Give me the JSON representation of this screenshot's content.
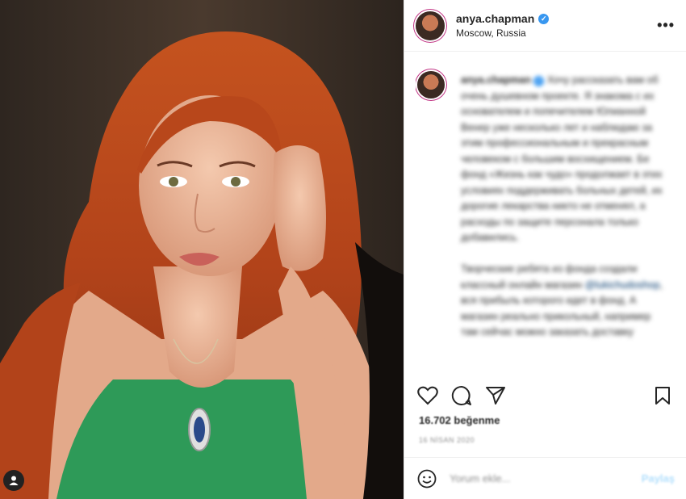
{
  "post": {
    "image_alt": "Portrait photo of a woman with long red hair",
    "tag_icon": "user-tag-icon"
  },
  "header": {
    "username": "anya.chapman",
    "verified": "✓",
    "location": "Moscow, Russia",
    "more": "•••"
  },
  "caption": {
    "username": "anya.chapman",
    "text1": "Хочу рассказать вам об очень душевном проекте. Я знакома с их основателем и попечителем Юлианной Венер уже несколько лет и наблюдаю за этим профессиональным и прекрасным человеком с большим восхищением. Бе фонд «Жизнь как чудо» продолжает в этих условиях поддерживать больных детей, их дорогие лекарства никто не отменял, а расходы по защите персонала только добавились.",
    "text2": "Творческие ребята из фонда создали классный онлайн магазин",
    "link": "@lukichudoshop",
    "text3": ", вся прибыль которого идет в фонд. А магазин реально прикольный, например там сейчас можно заказать доставку"
  },
  "stats": {
    "likes": "16.702 beğenme",
    "date": "16 NİSAN 2020"
  },
  "comment": {
    "placeholder": "Yorum ekle...",
    "post_label": "Paylaş"
  },
  "colors": {
    "verified": "#3897f0",
    "link": "#00376b",
    "muted": "#8e8e8e"
  }
}
